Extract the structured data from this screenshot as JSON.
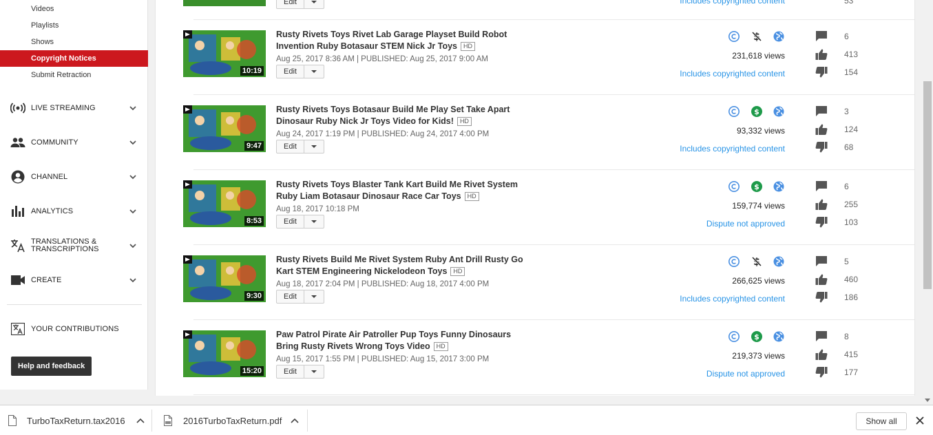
{
  "sidebar": {
    "sub_items": [
      "Videos",
      "Playlists",
      "Shows",
      "Copyright Notices",
      "Submit Retraction"
    ],
    "active_sub_item": "Copyright Notices",
    "sections": [
      {
        "label": "LIVE STREAMING",
        "icon": "live-streaming-icon"
      },
      {
        "label": "COMMUNITY",
        "icon": "community-icon"
      },
      {
        "label": "CHANNEL",
        "icon": "channel-icon"
      },
      {
        "label": "ANALYTICS",
        "icon": "analytics-icon"
      },
      {
        "label_line1": "TRANSLATIONS &",
        "label_line2": "TRANSCRIPTIONS",
        "icon": "translate-icon"
      },
      {
        "label": "CREATE",
        "icon": "create-video-icon"
      }
    ],
    "your_contributions": "YOUR CONTRIBUTIONS",
    "help_button": "Help and feedback"
  },
  "partial_row": {
    "edit_label": "Edit",
    "copyright_status": "Includes copyrighted content",
    "comments_partial": "53"
  },
  "videos": [
    {
      "title_line1": "Rusty Rivets Toys Rivet Lab Garage Playset Build Robot",
      "title_line2": "Invention Ruby Botasaur STEM Nick Jr Toys",
      "hd": "HD",
      "dates": "Aug 25, 2017 8:36 AM | PUBLISHED: Aug 25, 2017 9:00 AM",
      "duration": "10:19",
      "monetized": false,
      "views": "231,618 views",
      "copyright_status": "Includes copyrighted content",
      "comments": "6",
      "likes": "413",
      "dislikes": "154",
      "edit_label": "Edit"
    },
    {
      "title_line1": "Rusty Rivets Toys Botasaur Build Me Play Set Take Apart",
      "title_line2": "Dinosaur Ruby Nick Jr Toys Video for Kids!",
      "hd": "HD",
      "dates": "Aug 24, 2017 1:19 PM | PUBLISHED: Aug 24, 2017 4:00 PM",
      "duration": "9:47",
      "monetized": true,
      "views": "93,332 views",
      "copyright_status": "Includes copyrighted content",
      "comments": "3",
      "likes": "124",
      "dislikes": "68",
      "edit_label": "Edit"
    },
    {
      "title_line1": "Rusty Rivets Toys Blaster Tank Kart Build Me Rivet System",
      "title_line2": "Ruby Liam Botasaur Dinosaur Race Car Toys",
      "hd": "HD",
      "dates": "Aug 18, 2017 10:18 PM",
      "duration": "8:53",
      "monetized": true,
      "views": "159,774 views",
      "copyright_status": "Dispute not approved",
      "comments": "6",
      "likes": "255",
      "dislikes": "103",
      "edit_label": "Edit"
    },
    {
      "title_line1": "Rusty Rivets Build Me Rivet System Ruby Ant Drill Rusty Go",
      "title_line2": "Kart STEM Engineering Nickelodeon Toys",
      "hd": "HD",
      "dates": "Aug 18, 2017 2:04 PM | PUBLISHED: Aug 18, 2017 4:00 PM",
      "duration": "9:30",
      "monetized": false,
      "views": "266,625 views",
      "copyright_status": "Includes copyrighted content",
      "comments": "5",
      "likes": "460",
      "dislikes": "186",
      "edit_label": "Edit"
    },
    {
      "title_line1": "Paw Patrol Pirate Air Patroller Pup Toys Funny Dinosaurs",
      "title_line2": "Bring Rusty Rivets Wrong Toys Video",
      "hd": "HD",
      "dates": "Aug 15, 2017 1:55 PM | PUBLISHED: Aug 15, 2017 3:00 PM",
      "duration": "15:20",
      "monetized": true,
      "views": "219,373 views",
      "copyright_status": "Dispute not approved",
      "comments": "8",
      "likes": "415",
      "dislikes": "177",
      "edit_label": "Edit"
    }
  ],
  "downloads": {
    "items": [
      {
        "name": "TurboTaxReturn.tax2016",
        "icon": "file-icon"
      },
      {
        "name": "2016TurboTaxReturn.pdf",
        "icon": "pdf-file-icon"
      }
    ],
    "show_all": "Show all"
  },
  "colors": {
    "accent_red": "#cc181e",
    "link_blue": "#2793e6",
    "icon_blue": "#4a90e2",
    "monetized_green": "#1e9a4a",
    "icon_gray": "#555555"
  }
}
